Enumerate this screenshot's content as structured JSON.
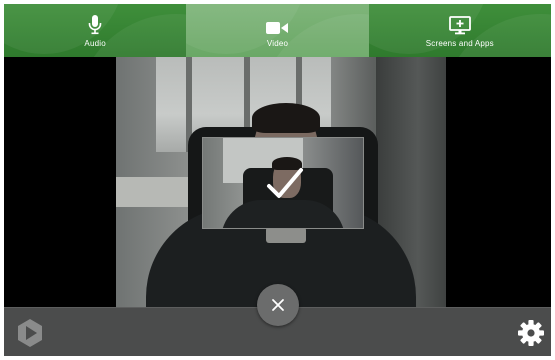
{
  "tabs": [
    {
      "label": "Audio",
      "icon": "microphone-icon",
      "active": false
    },
    {
      "label": "Video",
      "icon": "video-camera-icon",
      "active": true
    },
    {
      "label": "Screens and Apps",
      "icon": "screen-share-icon",
      "active": false
    }
  ],
  "colors": {
    "tabbar": "#2f7a2d",
    "tab_active": "#6aa866",
    "bottombar": "#4b4c4c",
    "close_button": "#6b6c6c"
  },
  "preview": {
    "selected_icon": "checkmark-icon"
  },
  "bottom": {
    "close_icon": "close-icon",
    "logo_icon": "play-logo-icon",
    "settings_icon": "gear-icon"
  }
}
